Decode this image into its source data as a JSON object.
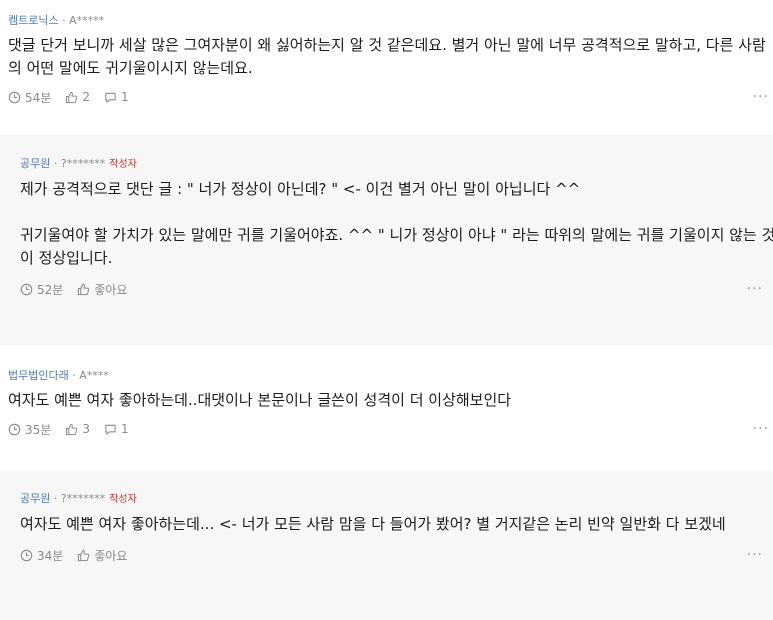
{
  "comments": [
    {
      "company": "켐트로닉스",
      "user": "A*****",
      "author_tag": "",
      "text": "댓글 단거 보니까 세살 많은 그여자분이 왜 싫어하는지 알 것 같은데요. 별거 아닌 말에 너무 공격적으로 말하고, 다른 사람의 어떤 말에도 귀기울이시지 않는데요.",
      "time": "54분",
      "like_label": "2",
      "reply_count": "1",
      "more": "···"
    },
    {
      "company": "공무원",
      "user": "?*******",
      "author_tag": "작성자",
      "text": "제가 공격적으로 댓단 글 : \" 너가 정상이 아닌데? \" <- 이건 별거 아닌 말이 아닙니다 ^^\n\n귀기울여야 할 가치가 있는 말에만 귀를 기울어야죠. ^^ \" 니가 정상이 아냐 \" 라는 따위의 말에는 귀를 기울이지 않는 것이 정상입니다.",
      "time": "52분",
      "like_label": "좋아요",
      "more": "···"
    },
    {
      "company": "법무법인다래",
      "user": "A****",
      "author_tag": "",
      "text": "여자도 예쁜 여자 좋아하는데..대댓이나 본문이나 글쓴이 성격이 더 이상해보인다",
      "time": "35분",
      "like_label": "3",
      "reply_count": "1",
      "more": "···"
    },
    {
      "company": "공무원",
      "user": "?*******",
      "author_tag": "작성자",
      "text": "여자도 예쁜 여자 좋아하는데... <- 너가 모든 사람 맘을 다 들어가 봤어? 별 거지같은 논리 빈약 일반화 다 보겠네",
      "time": "34분",
      "like_label": "좋아요",
      "more": "···"
    }
  ],
  "separator": " · "
}
